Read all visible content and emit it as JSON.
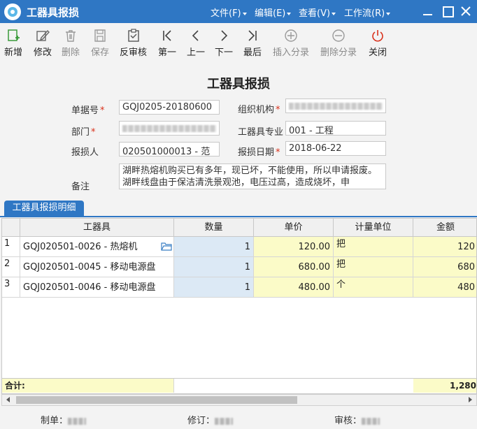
{
  "window": {
    "title": "工器具报损",
    "menus": [
      "文件(F)",
      "编辑(E)",
      "查看(V)",
      "工作流(R)"
    ]
  },
  "toolbar": {
    "new": "新增",
    "edit": "修改",
    "delete": "删除",
    "save": "保存",
    "unaudit": "反审核",
    "first": "第一",
    "prev": "上一",
    "next": "下一",
    "last": "最后",
    "insert_row": "插入分录",
    "delete_row": "删除分录",
    "close": "关闭"
  },
  "form": {
    "title": "工器具报损",
    "bill_no_label": "单据号",
    "bill_no": "GQJ0205-20180600",
    "org_label": "组织机构",
    "dept_label": "部门",
    "specialty_label": "工器具专业",
    "specialty": "001 - 工程",
    "reporter_label": "报损人",
    "reporter": "020501000013 - 范",
    "report_date_label": "报损日期",
    "report_date": "2018-06-22",
    "remark_label": "备注",
    "remark": "湖畔热熔机购买已有多年，现已坏，不能使用，所以申请报废。湖畔线盘由于保洁清洗景观池，电压过高，造成烧坏，申"
  },
  "detail_tab": "工器具报损明细",
  "grid": {
    "columns": [
      "工器具",
      "数量",
      "单价",
      "计量单位",
      "金额"
    ],
    "rows": [
      {
        "no": "1",
        "tool": "GQJ020501-0026 - 热熔机",
        "qty": "1",
        "price": "120.00",
        "unit": "把",
        "amount": "120"
      },
      {
        "no": "2",
        "tool": "GQJ020501-0045 - 移动电源盘",
        "qty": "1",
        "price": "680.00",
        "unit": "把",
        "amount": "680"
      },
      {
        "no": "3",
        "tool": "GQJ020501-0046 - 移动电源盘",
        "qty": "1",
        "price": "480.00",
        "unit": "个",
        "amount": "480"
      }
    ],
    "total_label": "合计:",
    "total_amount": "1,280"
  },
  "footer": {
    "maker_label": "制单：",
    "reviser_label": "修订：",
    "auditor_label": "审核："
  },
  "colors": {
    "titlebar": "#2f77c4",
    "required": "#d9301a",
    "editable_yellow": "#fbfbc8",
    "qty_blue": "#dce9f5",
    "new_icon": "#3a9a3a",
    "close_icon": "#d9301a"
  }
}
